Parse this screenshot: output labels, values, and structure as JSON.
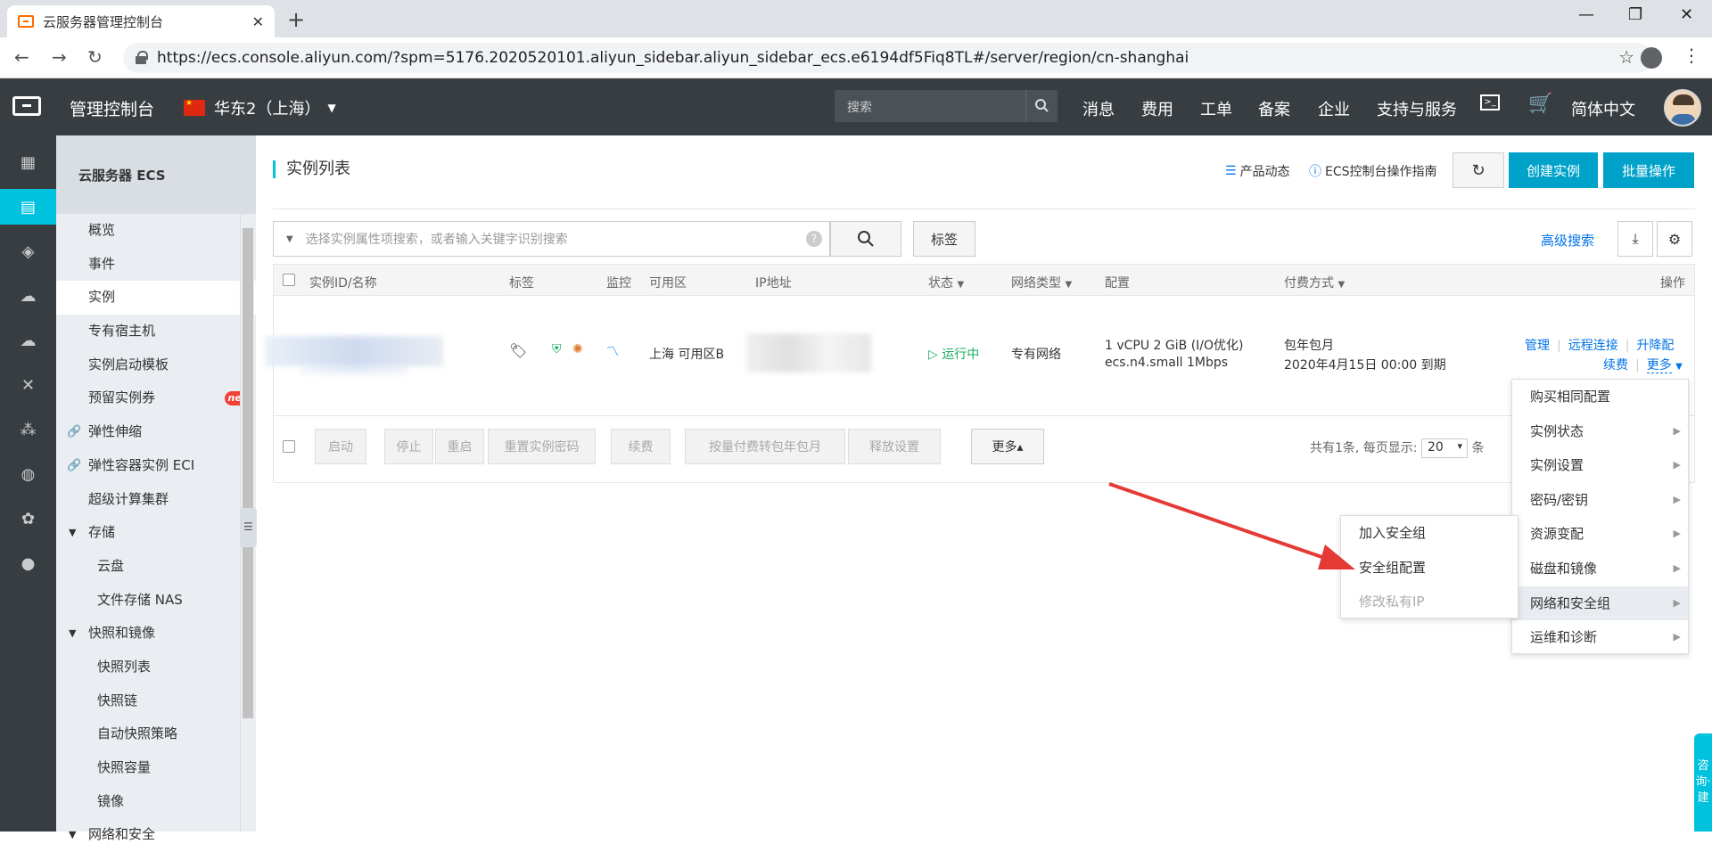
{
  "browser": {
    "tab_title": "云服务器管理控制台",
    "url": "https://ecs.console.aliyun.com/?spm=5176.2020520101.aliyun_sidebar.aliyun_sidebar_ecs.e6194df5Fiq8TL#/server/region/cn-shanghai"
  },
  "topbar": {
    "title": "管理控制台",
    "region": "华东2（上海）",
    "search_placeholder": "搜索",
    "nav": [
      "消息",
      "费用",
      "工单",
      "备案",
      "企业",
      "支持与服务",
      "简体中文"
    ]
  },
  "sidebar": {
    "header": "云服务器 ECS",
    "items": [
      {
        "label": "概览"
      },
      {
        "label": "事件"
      },
      {
        "label": "实例"
      },
      {
        "label": "专有宿主机"
      },
      {
        "label": "实例启动模板"
      },
      {
        "label": "预留实例券",
        "badge": "new"
      },
      {
        "label": "弹性伸缩"
      },
      {
        "label": "弹性容器实例 ECI"
      },
      {
        "label": "超级计算集群"
      },
      {
        "label": "存储"
      },
      {
        "label": "云盘"
      },
      {
        "label": "文件存储 NAS"
      },
      {
        "label": "快照和镜像"
      },
      {
        "label": "快照列表"
      },
      {
        "label": "快照链"
      },
      {
        "label": "自动快照策略"
      },
      {
        "label": "快照容量"
      },
      {
        "label": "镜像"
      },
      {
        "label": "网络和安全"
      }
    ]
  },
  "header": {
    "title": "实例列表",
    "product_news": "产品动态",
    "guide": "ECS控制台操作指南",
    "create": "创建实例",
    "batch": "批量操作"
  },
  "filter": {
    "placeholder": "选择实例属性项搜索，或者输入关键字识别搜索",
    "tag_button": "标签",
    "advanced": "高级搜索"
  },
  "table": {
    "columns": [
      "实例ID/名称",
      "标签",
      "监控",
      "可用区",
      "IP地址",
      "状态",
      "网络类型",
      "配置",
      "付费方式",
      "操作"
    ],
    "row": {
      "zone": "上海 可用区B",
      "status": "运行中",
      "network": "专有网络",
      "config_line1": "1 vCPU 2 GiB (I/O优化)",
      "config_line2": "ecs.n4.small   1Mbps",
      "billing_line1": "包年包月",
      "billing_line2": "2020年4月15日 00:00 到期",
      "actions": {
        "manage": "管理",
        "remote": "远程连接",
        "upgrade": "升降配",
        "renew": "续费",
        "more": "更多"
      }
    },
    "footer_buttons": [
      "启动",
      "停止",
      "重启",
      "重置实例密码",
      "续费",
      "按量付费转包年包月",
      "释放设置",
      "更多▴"
    ],
    "page_info_prefix": "共有1条, 每页显示:",
    "page_size": "20",
    "page_info_suffix": "条"
  },
  "more_menu": [
    "购买相同配置",
    "实例状态",
    "实例设置",
    "密码/密钥",
    "资源变配",
    "磁盘和镜像",
    "网络和安全组",
    "运维和诊断"
  ],
  "sub_menu": [
    "加入安全组",
    "安全组配置",
    "修改私有IP"
  ],
  "consult": "咨询·建"
}
